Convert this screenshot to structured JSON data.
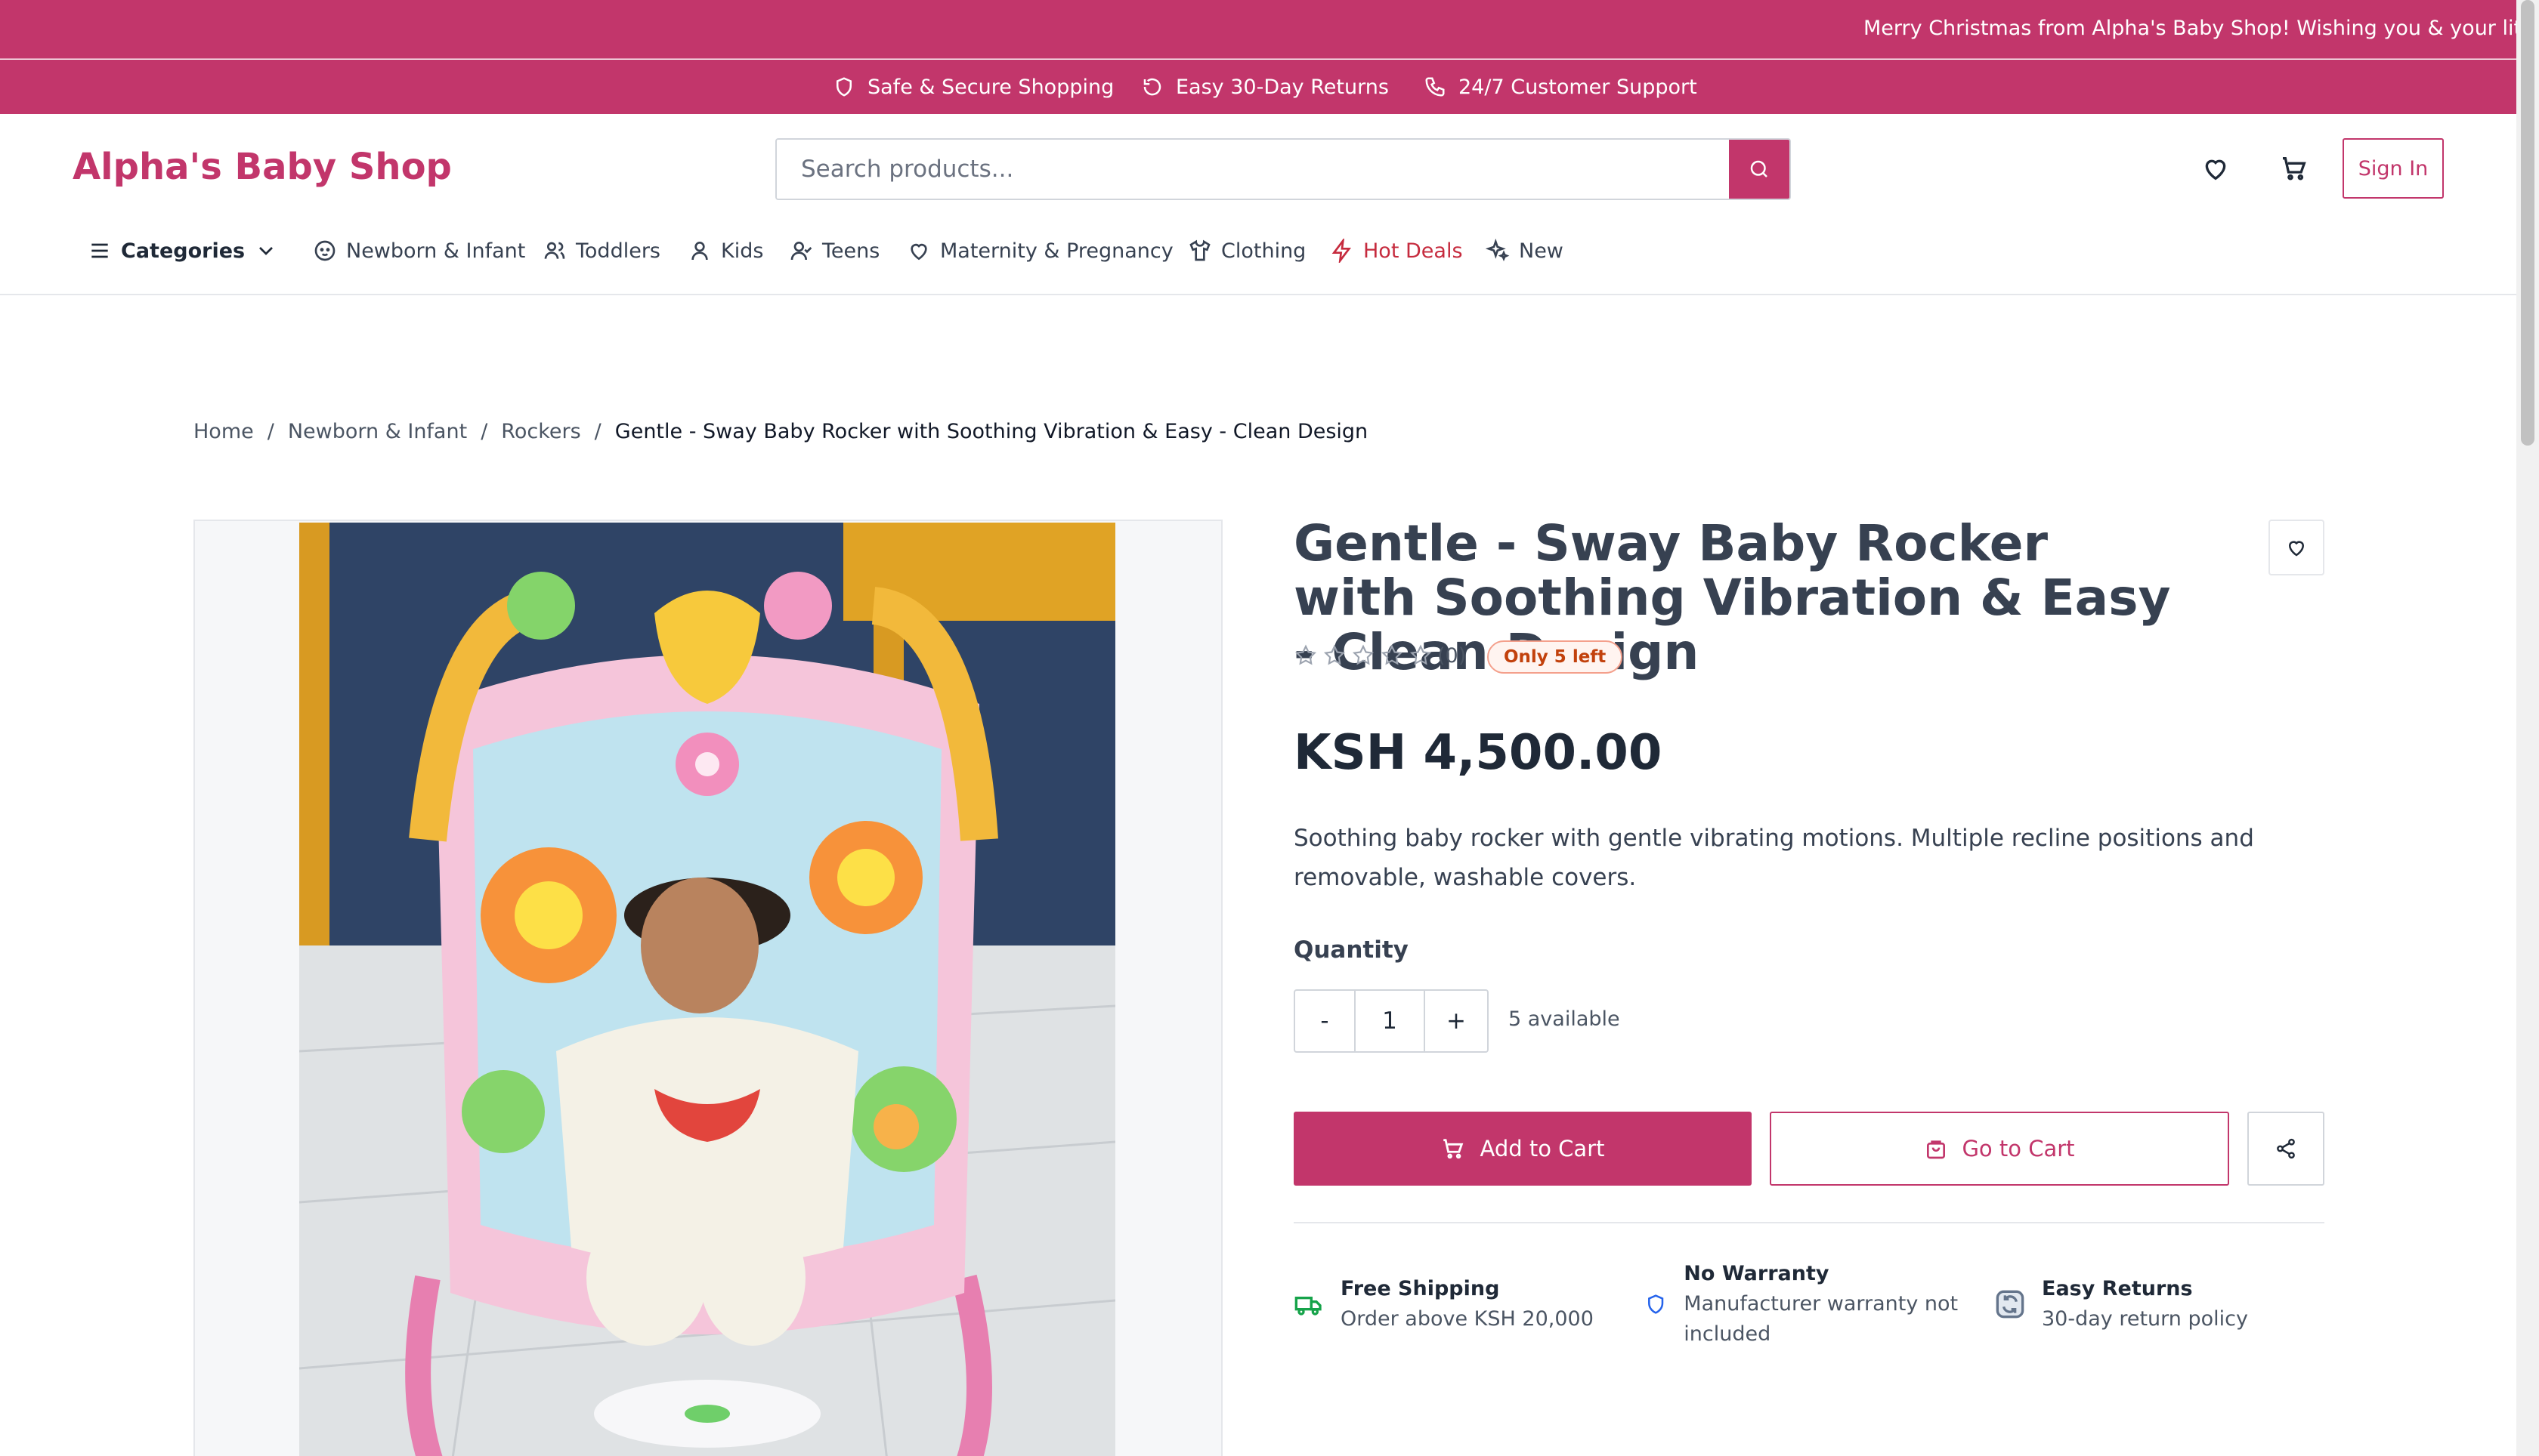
{
  "promo": {
    "text": "Merry Christmas from Alpha's Baby Shop! Wishing you & your little one"
  },
  "trust_bar": {
    "items": [
      {
        "label": "Safe & Secure Shopping",
        "icon": "shield-icon"
      },
      {
        "label": "Easy 30-Day Returns",
        "icon": "rotate-icon"
      },
      {
        "label": "24/7 Customer Support",
        "icon": "phone-icon"
      }
    ]
  },
  "header": {
    "logo": "Alpha's Baby Shop",
    "search_placeholder": "Search products...",
    "sign_in": "Sign In"
  },
  "nav": {
    "categories_label": "Categories",
    "items": [
      {
        "label": "Newborn & Infant",
        "icon": "baby-icon"
      },
      {
        "label": "Toddlers",
        "icon": "users-icon"
      },
      {
        "label": "Kids",
        "icon": "user-icon"
      },
      {
        "label": "Teens",
        "icon": "user-check-icon"
      },
      {
        "label": "Maternity & Pregnancy",
        "icon": "heart-icon"
      },
      {
        "label": "Clothing",
        "icon": "shirt-icon"
      },
      {
        "label": "Hot Deals",
        "icon": "zap-icon"
      },
      {
        "label": "New",
        "icon": "sparkles-icon"
      }
    ]
  },
  "breadcrumb": {
    "items": [
      "Home",
      "Newborn & Infant",
      "Rockers"
    ],
    "separator": "/",
    "current": "Gentle - Sway Baby Rocker with Soothing Vibration & Easy - Clean Design"
  },
  "product": {
    "title": "Gentle - Sway Baby Rocker with Soothing Vibration & Easy - Clean Design",
    "review_count": "(0)",
    "rating": 0,
    "stock_badge": "Only 5 left",
    "price": "KSH 4,500.00",
    "description": "Soothing baby rocker with gentle vibrating motions. Multiple recline positions and removable, washable covers.",
    "quantity_label": "Quantity",
    "quantity_minus": "-",
    "quantity_value": "1",
    "quantity_plus": "+",
    "available": "5 available",
    "add_to_cart": "Add to Cart",
    "go_to_cart": "Go to Cart"
  },
  "features": [
    {
      "title": "Free Shipping",
      "subtitle": "Order above KSH 20,000",
      "icon": "truck-icon"
    },
    {
      "title": "No Warranty",
      "subtitle": "Manufacturer warranty not included",
      "icon": "shield-icon"
    },
    {
      "title": "Easy Returns",
      "subtitle": "30-day return policy",
      "icon": "refresh-icon"
    }
  ],
  "colors": {
    "brand": "#c2366b",
    "hot_deals": "#c62b3e",
    "stock_badge": "#c2410c"
  }
}
